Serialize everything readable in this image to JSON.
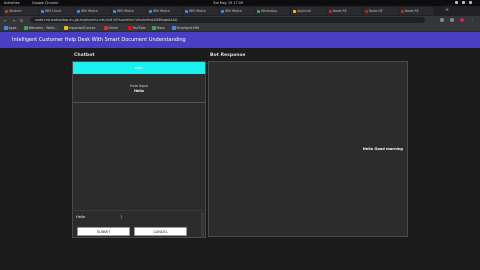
{
  "os": {
    "activities": "Activities",
    "app_name": "Google Chrome",
    "clock": "Tue May 19  17:09"
  },
  "browser": {
    "tabs": [
      {
        "label": "Student",
        "color": "#d93025",
        "active": false
      },
      {
        "label": "IBM Cloud",
        "color": "#4285f4",
        "active": false
      },
      {
        "label": "IBM Watso",
        "color": "#4285f4",
        "active": false
      },
      {
        "label": "IBM Watso",
        "color": "#4285f4",
        "active": false
      },
      {
        "label": "IBM Watso",
        "color": "#4285f4",
        "active": false
      },
      {
        "label": "IBM Watso",
        "color": "#4285f4",
        "active": false
      },
      {
        "label": "IBM Watso",
        "color": "#4285f4",
        "active": false
      },
      {
        "label": "WhatsApp",
        "color": "#34a853",
        "active": false
      },
      {
        "label": "Applicati",
        "color": "#fbbc04",
        "active": false
      },
      {
        "label": "Node-RE",
        "color": "#c5221f",
        "active": false
      },
      {
        "label": "Node-RE",
        "color": "#c5221f",
        "active": false
      },
      {
        "label": "Node-RE",
        "color": "#c5221f",
        "active": false
      }
    ],
    "url": "node-red-watsontap.eu-gb.mybluemix.net/ui/#!/0?socketid=Vbm0nflwkG8BfxgbAAAG",
    "bookmarks": [
      {
        "label": "Apps",
        "color": "#4285f4"
      },
      {
        "label": "Welcome - Wokt...",
        "color": "#34a853"
      },
      {
        "label": "ImportantCourse",
        "color": "#fbbc04"
      },
      {
        "label": "Gmail",
        "color": "#d93025"
      },
      {
        "label": "YouTube",
        "color": "#ff0000"
      },
      {
        "label": "Maps",
        "color": "#34a853"
      },
      {
        "label": "Smartgrid IBM",
        "color": "#4285f4"
      }
    ]
  },
  "app": {
    "title": "Intelligent Customer Help Desk With Smart Document Understanding",
    "chatbot": {
      "panel_title": "Chatbot",
      "reply_label": "reply",
      "user_label": "from Input",
      "user_message": "Hello",
      "input_value": "Hello",
      "submit_label": "SUBMIT",
      "cancel_label": "CANCEL"
    },
    "bot": {
      "panel_title": "Bot Response",
      "response_text": "Hello Good morning"
    }
  }
}
